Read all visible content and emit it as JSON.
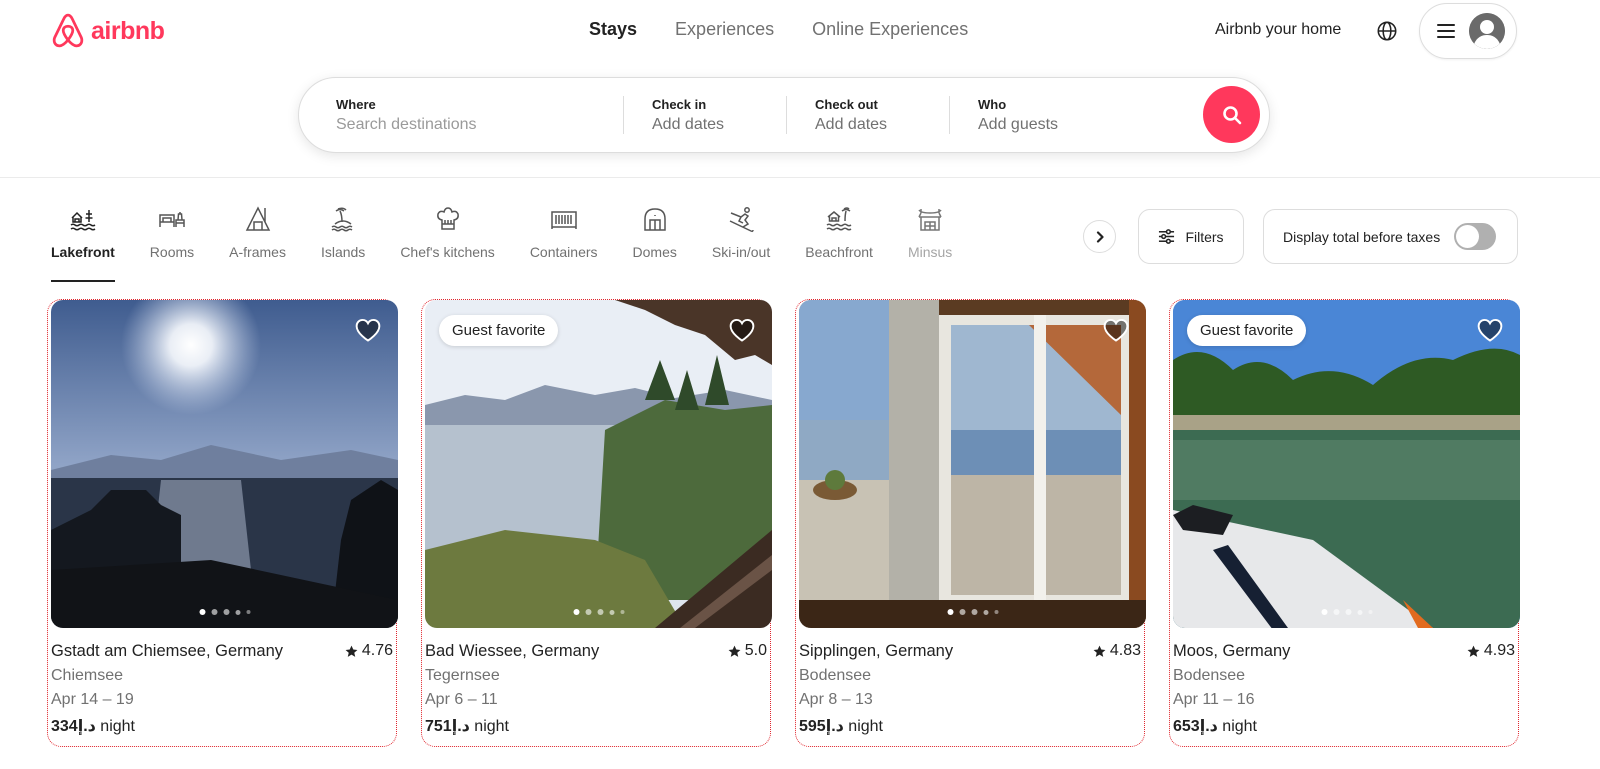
{
  "header": {
    "logo_text": "airbnb",
    "brand_color": "#ff385c",
    "nav_tabs": [
      {
        "label": "Stays",
        "active": true
      },
      {
        "label": "Experiences",
        "active": false
      },
      {
        "label": "Online Experiences",
        "active": false
      }
    ],
    "host_link": "Airbnb your home",
    "globe_icon": "globe-icon",
    "menu_icon": "hamburger-icon",
    "avatar_icon": "user-avatar-icon"
  },
  "search": {
    "where": {
      "label": "Where",
      "placeholder": "Search destinations",
      "value": ""
    },
    "check_in": {
      "label": "Check in",
      "value": "Add dates"
    },
    "check_out": {
      "label": "Check out",
      "value": "Add dates"
    },
    "who": {
      "label": "Who",
      "value": "Add guests"
    },
    "button_icon": "search-icon"
  },
  "categories": {
    "items": [
      {
        "label": "Lakefront",
        "icon": "lakefront-icon",
        "active": true
      },
      {
        "label": "Rooms",
        "icon": "rooms-icon",
        "active": false
      },
      {
        "label": "A-frames",
        "icon": "a-frame-icon",
        "active": false
      },
      {
        "label": "Islands",
        "icon": "island-icon",
        "active": false
      },
      {
        "label": "Chef's kitchens",
        "icon": "chef-hat-icon",
        "active": false
      },
      {
        "label": "Containers",
        "icon": "container-icon",
        "active": false
      },
      {
        "label": "Domes",
        "icon": "dome-icon",
        "active": false
      },
      {
        "label": "Ski-in/out",
        "icon": "skier-icon",
        "active": false
      },
      {
        "label": "Beachfront",
        "icon": "beachfront-icon",
        "active": false
      },
      {
        "label": "Minsus",
        "icon": "minsu-icon",
        "active": false
      }
    ],
    "next_icon": "chevron-right-icon",
    "filters_label": "Filters",
    "tax_toggle_label": "Display total before taxes",
    "tax_toggle_on": false
  },
  "listings": [
    {
      "title": "Gstadt am Chiemsee, Germany",
      "rating": "4.76",
      "subtitle": "Chiemsee",
      "dates": "Apr 14 – 19",
      "price": "334د.إ",
      "price_unit": "night",
      "badge": "",
      "photo_count": 5
    },
    {
      "title": "Bad Wiessee, Germany",
      "rating": "5.0",
      "subtitle": "Tegernsee",
      "dates": "Apr 6 – 11",
      "price": "751د.إ",
      "price_unit": "night",
      "badge": "Guest favorite",
      "photo_count": 5
    },
    {
      "title": "Sipplingen, Germany",
      "rating": "4.83",
      "subtitle": "Bodensee",
      "dates": "Apr 8 – 13",
      "price": "595د.إ",
      "price_unit": "night",
      "badge": "",
      "photo_count": 5
    },
    {
      "title": "Moos, Germany",
      "rating": "4.93",
      "subtitle": "Bodensee",
      "dates": "Apr 11 – 16",
      "price": "653د.إ",
      "price_unit": "night",
      "badge": "Guest favorite",
      "photo_count": 5
    }
  ]
}
